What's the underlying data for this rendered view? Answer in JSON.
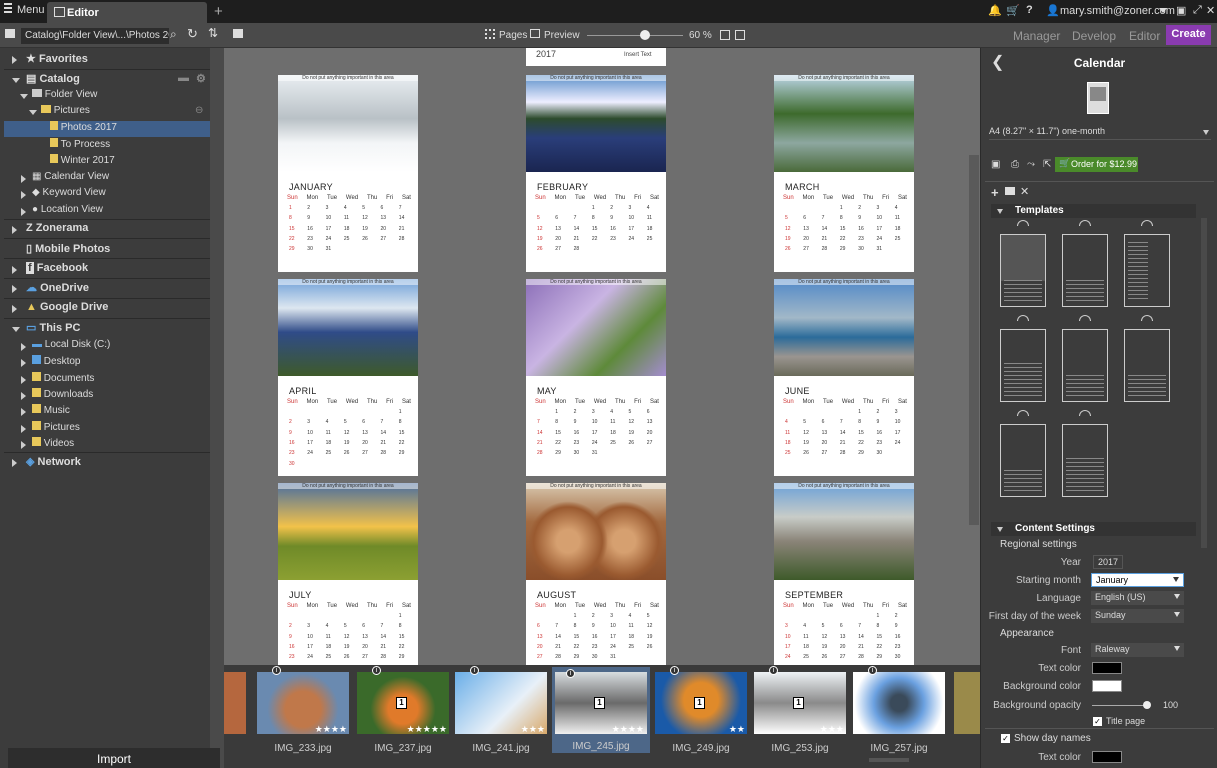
{
  "titlebar": {
    "menu": "Menu",
    "tab": "Editor",
    "user": "mary.smith@zoner.com"
  },
  "toolbar": {
    "path": "Catalog\\Folder View\\...\\Photos 2017",
    "pages": "Pages",
    "preview": "Preview",
    "zoom": "60 %",
    "zoom_level": 0.6
  },
  "modes": {
    "manager": "Manager",
    "develop": "Develop",
    "editor": "Editor",
    "create": "Create"
  },
  "sidebar": {
    "favorites": "Favorites",
    "catalog": "Catalog",
    "folder_view": "Folder View",
    "pictures": "Pictures",
    "photos2017": "Photos 2017",
    "to_process": "To Process",
    "winter": "Winter 2017",
    "calendar_view": "Calendar View",
    "keyword_view": "Keyword View",
    "location_view": "Location View",
    "zonerama": "Zonerama",
    "mobile": "Mobile Photos",
    "facebook": "Facebook",
    "onedrive": "OneDrive",
    "gdrive": "Google Drive",
    "thispc": "This PC",
    "localdisk": "Local Disk (C:)",
    "desktop": "Desktop",
    "documents": "Documents",
    "downloads": "Downloads",
    "music": "Music",
    "pictures2": "Pictures",
    "videos": "Videos",
    "network": "Network"
  },
  "import": "Import",
  "canvas": {
    "top_year": "2017",
    "top_insert": "Insert Text",
    "note": "Do not put anything important in this area",
    "days": [
      "Sun",
      "Mon",
      "Tue",
      "Wed",
      "Thu",
      "Fri",
      "Sat"
    ],
    "months": [
      {
        "name": "JANUARY",
        "photo": "snow",
        "start": 0,
        "len": 31
      },
      {
        "name": "FEBRUARY",
        "photo": "mountain",
        "start": 3,
        "len": 28
      },
      {
        "name": "MARCH",
        "photo": "river",
        "start": 3,
        "len": 31
      },
      {
        "name": "APRIL",
        "photo": "lake",
        "start": 6,
        "len": 30
      },
      {
        "name": "MAY",
        "photo": "lavender",
        "start": 1,
        "len": 31
      },
      {
        "name": "JUNE",
        "photo": "rock",
        "start": 4,
        "len": 30
      },
      {
        "name": "JULY",
        "photo": "sunset",
        "start": 6,
        "len": 31
      },
      {
        "name": "AUGUST",
        "photo": "hay",
        "start": 2,
        "len": 31
      },
      {
        "name": "SEPTEMBER",
        "photo": "cliff",
        "start": 5,
        "len": 30
      }
    ]
  },
  "filmstrip": [
    {
      "name": "IMG_233.jpg",
      "stars": 4
    },
    {
      "name": "IMG_237.jpg",
      "stars": 5,
      "badge": "1"
    },
    {
      "name": "IMG_241.jpg",
      "stars": 3
    },
    {
      "name": "IMG_245.jpg",
      "stars": 4,
      "badge": "1"
    },
    {
      "name": "IMG_249.jpg",
      "stars": 2,
      "badge": "1"
    },
    {
      "name": "IMG_253.jpg",
      "stars": 3,
      "badge": "1"
    },
    {
      "name": "IMG_257.jpg",
      "stars": 1
    }
  ],
  "rpanel": {
    "title": "Calendar",
    "format": "A4 (8.27\" × 11.7\") one-month",
    "order": "Order for $12.99",
    "templates": "Templates",
    "content_settings": "Content Settings",
    "regional": "Regional settings",
    "year_label": "Year",
    "year": "2017",
    "start_label": "Starting month",
    "start": "January",
    "lang_label": "Language",
    "lang": "English (US)",
    "fdow_label": "First day of the week",
    "fdow": "Sunday",
    "appearance": "Appearance",
    "font_label": "Font",
    "font": "Raleway",
    "textcolor_label": "Text color",
    "bg_label": "Background color",
    "opacity_label": "Background opacity",
    "opacity": "100",
    "title_page": "Title page",
    "show_day_names": "Show day names",
    "textcolor2_label": "Text color",
    "colors": {
      "text": "#000000",
      "background": "#ffffff",
      "accent": "#8a3bb0",
      "order": "#4a8a2a"
    }
  }
}
